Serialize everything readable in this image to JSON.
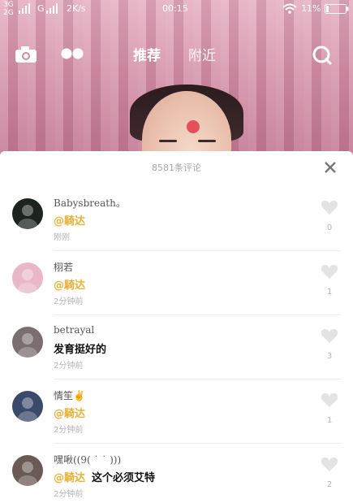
{
  "status_bar": {
    "signal_top": "3G",
    "signal_bottom": "2G",
    "carrier": "G",
    "speed": "2K/s",
    "time": "00:15",
    "battery": "11%"
  },
  "nav": {
    "tab_recommend": "推荐",
    "tab_nearby": "附近",
    "icons": [
      "camera-icon",
      "dots-icon",
      "search-icon"
    ]
  },
  "comments_panel": {
    "count_label": "8581条评论",
    "comments": [
      {
        "username": "Babysbreath。",
        "mention": "@騎达",
        "text": "",
        "time": "刚刚",
        "likes": "0",
        "avatar_color": "#1c2420"
      },
      {
        "username": "栩若",
        "mention": "@騎达",
        "text": "",
        "time": "2分钟前",
        "likes": "1",
        "avatar_color": "#e8b8c8"
      },
      {
        "username": "betrayal",
        "mention": "",
        "text": "发育挺好的",
        "time": "2分钟前",
        "likes": "3",
        "avatar_color": "#7a6e70"
      },
      {
        "username": "情笙✌",
        "mention": "@騎达",
        "text": "",
        "time": "2分钟前",
        "likes": "1",
        "avatar_color": "#3a4a6a"
      },
      {
        "username": "嘿啾((9( ˙ ˙ )))",
        "mention": "@騎达",
        "text": "这个必须艾特",
        "time": "2分钟前",
        "likes": "2",
        "avatar_color": "#6a5a55"
      }
    ]
  }
}
